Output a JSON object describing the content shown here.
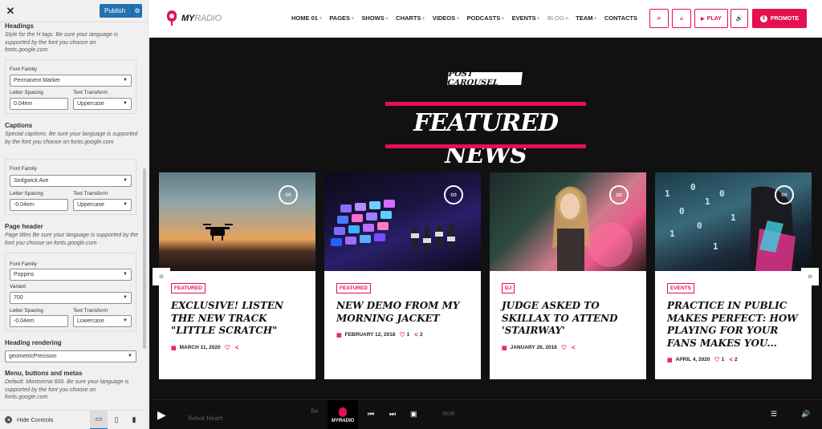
{
  "sidebar": {
    "close_label": "✕",
    "publish_label": "Publish",
    "publish_gear": "⚙",
    "sections": {
      "headings": {
        "title": "Headings",
        "desc": "Style for the H tags. Be sure your language is supported by the font you choose on fonts.google.com",
        "font_family_label": "Font Family",
        "font_family_value": "Permanent Marker",
        "letter_spacing_label": "Letter Spacing",
        "letter_spacing_value": "0.04em",
        "text_transform_label": "Text Transform",
        "text_transform_value": "Uppercase"
      },
      "captions": {
        "title": "Captions",
        "desc": "Special captions. Be sure your language is supported by the font you choose on fonts.google.com",
        "font_family_label": "Font Family",
        "font_family_value": "Sedgwick Ave",
        "letter_spacing_label": "Letter Spacing",
        "letter_spacing_value": "-0.04em",
        "text_transform_label": "Text Transform",
        "text_transform_value": "Uppercase"
      },
      "page_header": {
        "title": "Page header",
        "desc": "Page titles Be sure your language is supported by the font you choose on fonts.google.com",
        "font_family_label": "Font Family",
        "font_family_value": "Poppins",
        "variant_label": "Variant",
        "variant_value": "700",
        "letter_spacing_label": "Letter Spacing",
        "letter_spacing_value": "-0.04em",
        "text_transform_label": "Text Transform",
        "text_transform_value": "Lowercase"
      },
      "heading_rendering": {
        "title": "Heading rendering",
        "value": "geometricPrecision"
      },
      "menu": {
        "title": "Menu, buttons and metas",
        "desc": "Default: Montserrat 600. Be sure your language is supported by the font you choose on fonts.google.com"
      }
    },
    "hide_controls_label": "Hide Controls",
    "devices": [
      "desktop-icon",
      "tablet-icon",
      "mobile-icon"
    ]
  },
  "header": {
    "logo_main": "MY",
    "logo_accent": "RADIO",
    "nav": [
      {
        "label": "HOME 01",
        "plus": "+"
      },
      {
        "label": "PAGES",
        "plus": "+"
      },
      {
        "label": "SHOWS",
        "plus": "+"
      },
      {
        "label": "CHARTS",
        "plus": "+"
      },
      {
        "label": "VIDEOS",
        "plus": "+"
      },
      {
        "label": "PODCASTS",
        "plus": "+"
      },
      {
        "label": "EVENTS",
        "plus": "+"
      },
      {
        "label": "BLOG",
        "plus": "+"
      },
      {
        "label": "TEAM",
        "plus": "+"
      },
      {
        "label": "CONTACTS",
        "plus": ""
      }
    ],
    "search_icon": "⌕",
    "menu_icon": "≡",
    "play_label": "PLAY",
    "play_icon": "▶",
    "volume_icon": "🔊",
    "promote_label": "PROMOTE",
    "accent": "#e4104f"
  },
  "carousel": {
    "subtitle": "POST CAROUSEL",
    "title": "FEATURED NEWS",
    "prev_icon": "«",
    "next_icon": "»",
    "cards": [
      {
        "category": "FEATURED",
        "title": "EXCLUSIVE! LISTEN THE NEW TRACK \"LITTLE SCRATCH\"",
        "date": "MARCH 11, 2020",
        "likes": "",
        "shares": ""
      },
      {
        "category": "FEATURED",
        "title": "NEW DEMO FROM MY MORNING JACKET",
        "date": "FEBRUARY 12, 2018",
        "likes": "1",
        "shares": "2"
      },
      {
        "category": "DJ",
        "title": "JUDGE ASKED TO SKILLAX TO ATTEND 'STAIRWAY'",
        "date": "JANUARY 26, 2018",
        "likes": "",
        "shares": ""
      },
      {
        "category": "EVENTS",
        "title": "PRACTICE IN PUBLIC MAKES PERFECT: HOW PLAYING FOR YOUR FANS MAKES YOU...",
        "date": "APRIL 4, 2020",
        "likes": "1",
        "shares": "2"
      }
    ]
  },
  "player": {
    "track": "Robot Heart",
    "track_right": "Re",
    "logo_main": "MY",
    "logo_accent": "RADIO",
    "time": "00:00"
  }
}
